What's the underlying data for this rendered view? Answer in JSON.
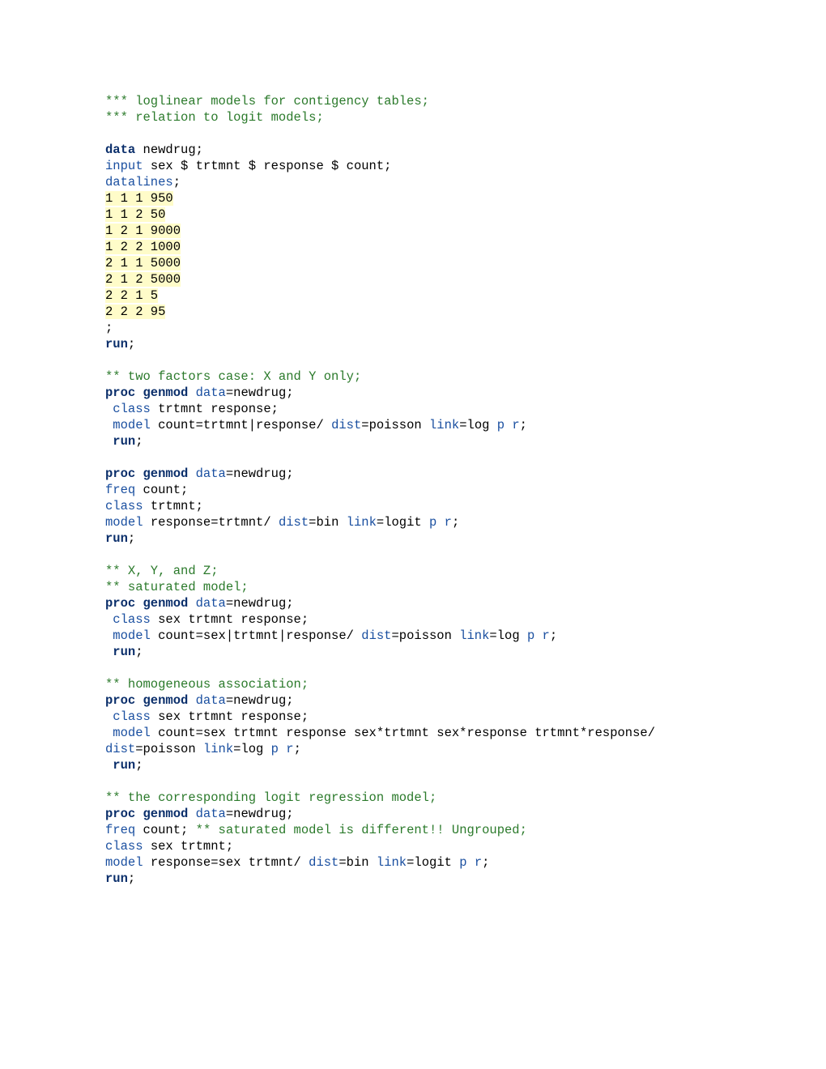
{
  "c1": "*** loglinear models for contigency tables;",
  "c2": "*** relation to logit models;",
  "d_kw": "data",
  "d_nm": " newdrug;",
  "i_kw": "input",
  "i_rest": " sex $ trtmnt $ response $ count;",
  "dl": "datalines",
  "sc": ";",
  "r1": "1 1 1 950",
  "r2": "1 1 2 50",
  "r3": "1 2 1 9000",
  "r4": "1 2 2 1000",
  "r5": "2 1 1 5000",
  "r6": "2 1 2 5000",
  "r7": "2 2 1 5",
  "r8": "2 2 2 95",
  "semi": ";",
  "run": "run",
  "runsc": ";",
  "c3": "** two factors case: X and Y only;",
  "pg": "proc genmod",
  "dataeq": " data",
  "eqnewdrug": "=newdrug;",
  "class": " class",
  "cl1": " trtmnt response;",
  "model": " model",
  "m1a": " count=trtmnt|response/ ",
  "dist": "dist",
  "eqpoisson": "=poisson ",
  "link": "link",
  "eqlog": "=log ",
  "pr": "p r",
  "end": ";",
  "run_sp": " run",
  "freq": "freq",
  "freqcount": " count;",
  "class0": "class",
  "cl2": " trtmnt;",
  "model0": "model",
  "m2a": " response=trtmnt/ ",
  "eqbin": "=bin ",
  "eqlogit": "=logit ",
  "c4": "** X, Y, and Z;",
  "c5": "** saturated model;",
  "cl3": " sex trtmnt response;",
  "m3a": " count=sex|trtmnt|response/ ",
  "c6": "** homogeneous association;",
  "m4a": " count=sex trtmnt response sex*trtmnt sex*response trtmnt*response/",
  "dist0": "dist",
  "c7": "** the corresponding logit regression model;",
  "fc2": " count; ",
  "c8": "** saturated model is different!! Ungrouped;",
  "cl5": " sex trtmnt;",
  "m5a": " response=sex trtmnt/ "
}
